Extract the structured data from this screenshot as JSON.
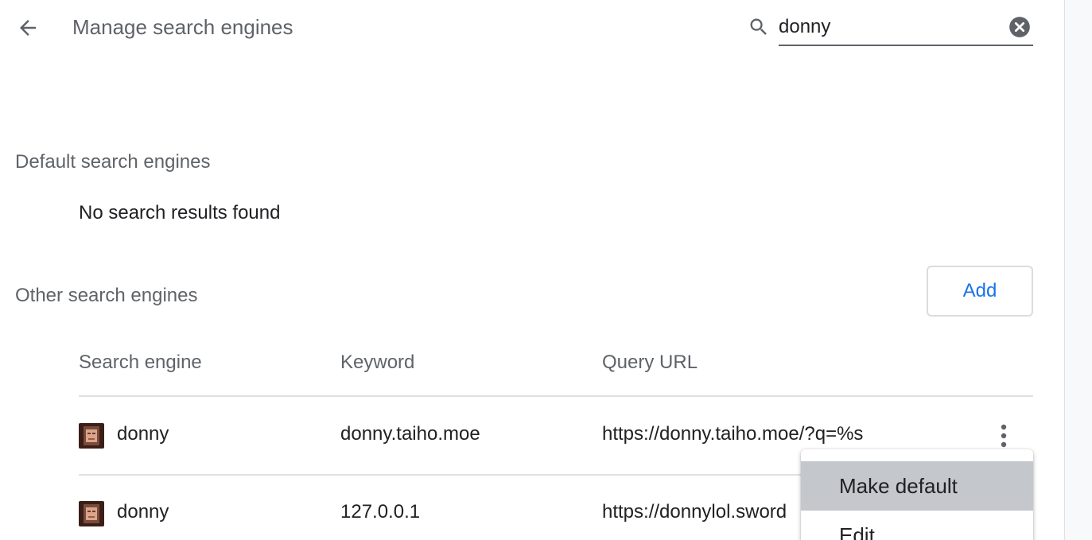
{
  "header": {
    "back_icon": "arrow-back-icon",
    "title": "Manage search engines"
  },
  "search": {
    "icon": "search-icon",
    "value": "donny",
    "clear_icon": "clear-circle-icon"
  },
  "default_section": {
    "title": "Default search engines",
    "empty_message": "No search results found"
  },
  "other_section": {
    "title": "Other search engines",
    "add_label": "Add",
    "columns": [
      "Search engine",
      "Keyword",
      "Query URL"
    ],
    "rows": [
      {
        "name": "donny",
        "keyword": "donny.taiho.moe",
        "url": "https://donny.taiho.moe/?q=%s"
      },
      {
        "name": "donny",
        "keyword": "127.0.0.1",
        "url": "https://donnylol.sword"
      }
    ]
  },
  "menu": {
    "items": [
      "Make default",
      "Edit"
    ]
  },
  "colors": {
    "accent": "#1a73e8",
    "menu_highlight": "#c4c7cc",
    "secondary_text": "#5f6368"
  }
}
